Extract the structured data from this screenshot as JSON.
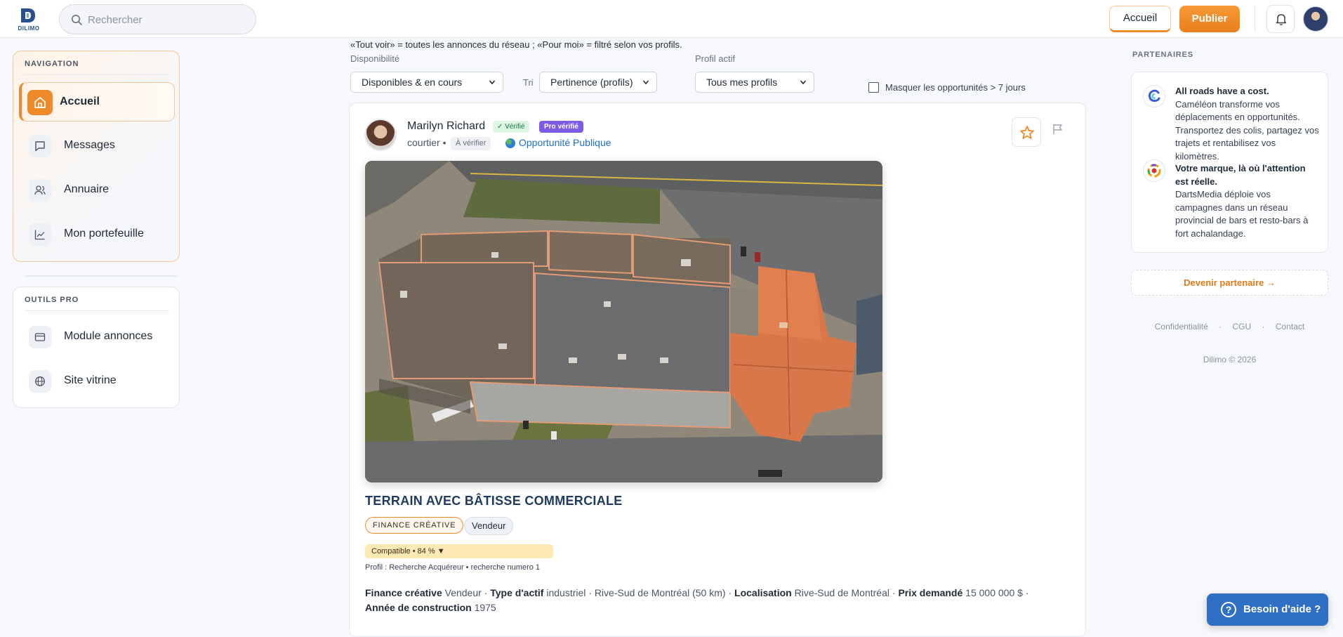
{
  "brand": {
    "name": "DILIMO",
    "accent": "#ef8a2a",
    "primary": "#2a4f8f"
  },
  "search": {
    "placeholder": "Rechercher",
    "icon": "search-icon"
  },
  "header": {
    "home_label": "Accueil",
    "publish_label": "Publier",
    "bell_icon": "bell-icon"
  },
  "sidebar": {
    "nav_title": "NAVIGATION",
    "nav_items": [
      {
        "label": "Accueil",
        "icon": "home-icon",
        "active": true
      },
      {
        "label": "Messages",
        "icon": "chat-icon",
        "active": false
      },
      {
        "label": "Annuaire",
        "icon": "users-icon",
        "active": false
      },
      {
        "label": "Mon portefeuille",
        "icon": "chart-line-icon",
        "active": false
      }
    ],
    "tools_title": "OUTILS PRO",
    "tools_items": [
      {
        "label": "Module annonces",
        "icon": "card-icon"
      },
      {
        "label": "Site vitrine",
        "icon": "globe-icon"
      }
    ]
  },
  "filters": {
    "hint": "«Tout voir» = toutes les annonces du réseau ; «Pour moi» = filtré selon vos profils.",
    "availability_label": "Disponibilité",
    "availability_value": "Disponibles & en cours",
    "sort_label": "Tri",
    "sort_value": "Pertinence (profils)",
    "profile_label": "Profil actif",
    "profile_value": "Tous mes profils",
    "hide_old_label": "Masquer les opportunités > 7 jours",
    "hide_old_checked": false
  },
  "listing": {
    "author_name": "Marilyn Richard",
    "verified_badge": "✓ Vérifié",
    "pro_badge": "Pro vérifié",
    "role": "courtier •",
    "to_verify_badge": "À vérifier",
    "visibility": "Opportunité Publique",
    "title": "TERRAIN AVEC BÂTISSE COMMERCIALE",
    "tag_primary": "FINANCE CRÉATIVE",
    "tag_secondary": "Vendeur",
    "compatibility": "Compatible • 84 % ▼",
    "compatibility_percent": 84,
    "profile_line": "Profil : Recherche Acquéreur • recherche numero 1",
    "details": {
      "finance_label": "Finance créative",
      "finance_value": "Vendeur",
      "sep1": "·",
      "asset_label": "Type d'actif",
      "asset_value": "industriel · Rive-Sud de Montréal (50 km)",
      "sep2": "·",
      "location_label": "Localisation",
      "location_value": "Rive-Sud de Montréal",
      "sep3": "·",
      "price_label": "Prix demandé",
      "price_value": "15 000 000 $",
      "sep4": "·",
      "year_label": "Année de construction",
      "year_value": "1975"
    }
  },
  "partners": {
    "title": "PARTENAIRES",
    "items": [
      {
        "headline": "All roads have a cost.",
        "body": "Caméléon transforme vos déplacements en opportunités. Transportez des colis, partagez vos trajets et rentabilisez vos kilomètres.",
        "icon": "cameleon-logo-icon"
      },
      {
        "headline": "Votre marque, là où l'attention est réelle.",
        "body": "DartsMedia déploie vos campagnes dans un réseau provincial de bars et resto-bars à fort achalandage.",
        "icon": "dartsmedia-logo-icon"
      }
    ],
    "become_label": "Devenir partenaire →"
  },
  "footer": {
    "links": [
      "Confidentialité",
      "CGU",
      "Contact"
    ],
    "separator": "·",
    "copyright": "Dilimo © 2026"
  },
  "help": {
    "label": "Besoin d'aide ?",
    "icon_glyph": "?"
  }
}
